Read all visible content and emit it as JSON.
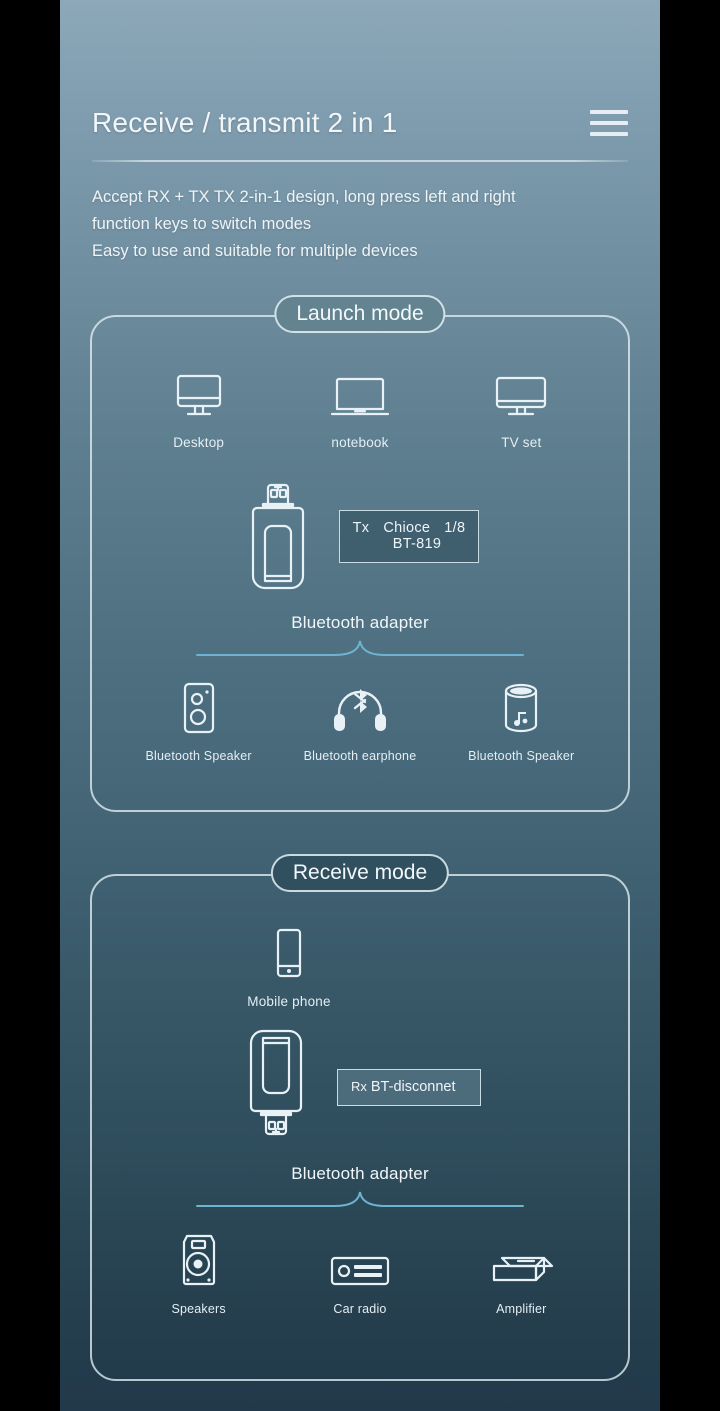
{
  "theme": {
    "bg_top": "#8ca8b9",
    "bg_bottom": "#21394a",
    "line_color": "#e8f1f6",
    "accent_curve": "#6fb3d2",
    "letterbox": "#000000"
  },
  "header": {
    "title": "Receive / transmit 2 in 1",
    "menu_icon": "hamburger-menu-icon",
    "subtitle_lines": [
      "Accept RX + TX TX 2-in-1 design, long press left and right",
      "function keys to switch modes",
      "Easy to use and suitable for multiple devices"
    ]
  },
  "launch_mode": {
    "title": "Launch mode",
    "sources": [
      {
        "icon": "desktop-monitor-icon",
        "label": "Desktop"
      },
      {
        "icon": "laptop-icon",
        "label": "notebook"
      },
      {
        "icon": "tv-icon",
        "label": "TV set"
      }
    ],
    "adapter": {
      "icon": "usb-dongle-icon",
      "label": "Bluetooth adapter",
      "display": {
        "mode": "Tx",
        "state": "Chioce",
        "index": "1/8",
        "device": "BT-819"
      }
    },
    "targets": [
      {
        "icon": "bluetooth-speaker-box-icon",
        "label": "Bluetooth Speaker"
      },
      {
        "icon": "bluetooth-headphone-icon",
        "label": "Bluetooth earphone"
      },
      {
        "icon": "bluetooth-speaker-cylinder-icon",
        "label": "Bluetooth Speaker"
      }
    ]
  },
  "receive_mode": {
    "title": "Receive mode",
    "sources": [
      {
        "icon": "mobile-phone-icon",
        "label": "Mobile phone"
      }
    ],
    "adapter": {
      "icon": "usb-dongle-flipped-icon",
      "label": "Bluetooth adapter",
      "display": {
        "mode": "Rx",
        "status": "BT-disconnet"
      }
    },
    "targets": [
      {
        "icon": "studio-speaker-icon",
        "label": "Speakers"
      },
      {
        "icon": "car-radio-icon",
        "label": "Car radio"
      },
      {
        "icon": "amplifier-icon",
        "label": "Amplifier"
      }
    ]
  }
}
